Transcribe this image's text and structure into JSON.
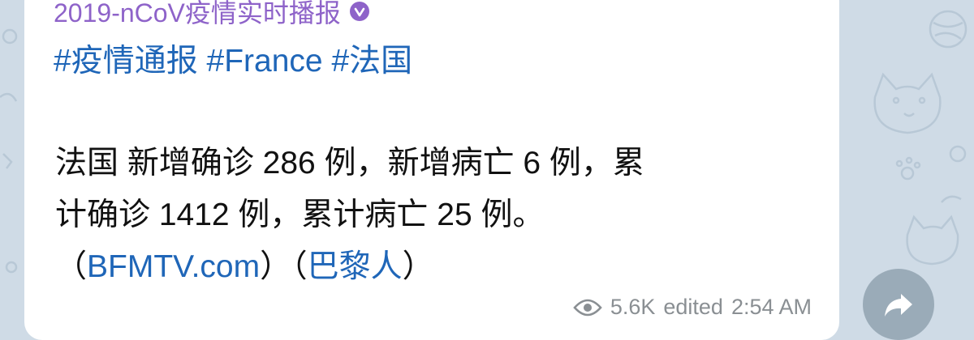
{
  "channel": {
    "name": "2019-nCoV疫情实时播报",
    "verified_icon": "verified-badge-icon",
    "name_color": "#8e63c9"
  },
  "hashtags": [
    "#疫情通报",
    "#France",
    "#法国"
  ],
  "message": {
    "line1": "法国 新增确诊 286 例，新增病亡 6 例，累",
    "line2": "计确诊 1412 例，累计病亡 25 例。",
    "line3_open1": "（",
    "link1": "BFMTV.com",
    "line3_close1": "）",
    "line3_open2": "（",
    "link2": "巴黎人",
    "line3_close2": "）"
  },
  "meta": {
    "views_icon": "eye-icon",
    "views": "5.6K",
    "edited_label": "edited",
    "time": "2:54 AM"
  },
  "share_button": {
    "icon": "share-arrow-icon"
  },
  "colors": {
    "link": "#1f66b8",
    "wallpaper": "#cfdbe6",
    "bubble": "#ffffff",
    "meta_text": "#8a8f93"
  }
}
